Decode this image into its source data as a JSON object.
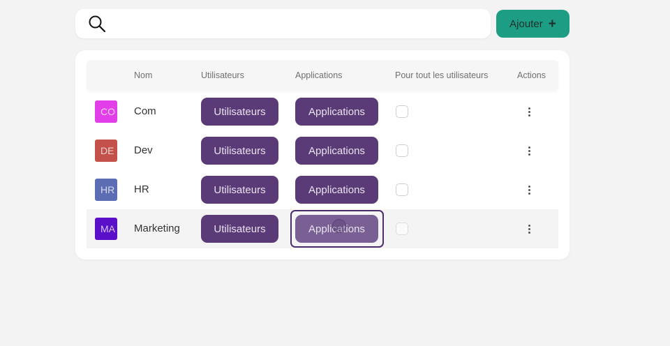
{
  "search": {
    "placeholder": "",
    "value": ""
  },
  "toolbar": {
    "add_label": "Ajouter",
    "add_icon": "plus-icon"
  },
  "table": {
    "headers": {
      "name": "Nom",
      "users": "Utilisateurs",
      "apps": "Applications",
      "all_users": "Pour tout les utilisateurs",
      "actions": "Actions"
    },
    "rows": [
      {
        "avatar": "CO",
        "avatar_color": "#e23fe8",
        "name": "Com",
        "users_label": "Utilisateurs",
        "apps_label": "Applications",
        "all_users": false
      },
      {
        "avatar": "DE",
        "avatar_color": "#c4504a",
        "name": "Dev",
        "users_label": "Utilisateurs",
        "apps_label": "Applications",
        "all_users": false
      },
      {
        "avatar": "HR",
        "avatar_color": "#5c6db4",
        "name": "HR",
        "users_label": "Utilisateurs",
        "apps_label": "Applications",
        "all_users": false
      },
      {
        "avatar": "MA",
        "avatar_color": "#5a10c8",
        "name": "Marketing",
        "users_label": "Utilisateurs",
        "apps_label": "Applications",
        "all_users": false
      }
    ]
  },
  "colors": {
    "accent": "#1d9e84",
    "pill": "#5a3b78",
    "pill_hover": "#7a5f95",
    "background": "#f3f3f4"
  }
}
